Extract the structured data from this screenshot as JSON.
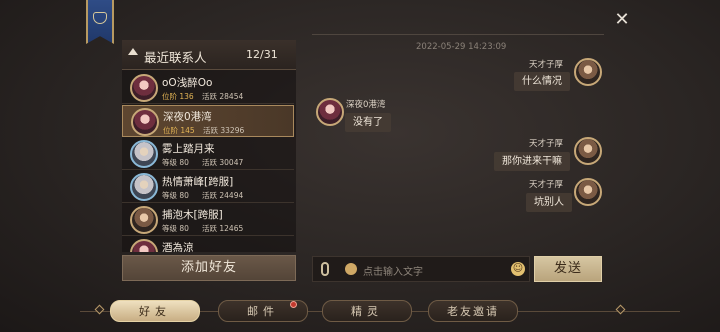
{
  "sidebar": {
    "header_title": "最近联系人",
    "count": "12/31",
    "contacts": [
      {
        "name": "oO浅醉Oo",
        "level": "位阶 136",
        "activity": "活跃 28454"
      },
      {
        "name": "深夜0港湾",
        "level": "位阶 145",
        "activity": "活跃 33296"
      },
      {
        "name": "雾上踏月来",
        "level": "等级 80",
        "activity": "活跃 30047"
      },
      {
        "name": "热情萧峰[跨服]",
        "level": "等级 80",
        "activity": "活跃 24494"
      },
      {
        "name": "捕泡木[跨服]",
        "level": "等级 80",
        "activity": "活跃 12465"
      },
      {
        "name": "酒為涼",
        "level": "",
        "activity": ""
      }
    ],
    "add_friend_label": "添加好友"
  },
  "chat": {
    "timestamp": "2022-05-29 14:23:09",
    "messages": [
      {
        "sender": "天才子厚",
        "text": "什么情况",
        "side": "right"
      },
      {
        "sender": "深夜0港湾",
        "text": "没有了",
        "side": "left"
      },
      {
        "sender": "天才子厚",
        "text": "那你进来干嘛",
        "side": "right"
      },
      {
        "sender": "天才子厚",
        "text": "坑别人",
        "side": "right"
      }
    ],
    "input_placeholder": "点击输入文字",
    "send_label": "发送"
  },
  "tabs": [
    {
      "label": "好友",
      "active": true
    },
    {
      "label": "邮件",
      "active": false,
      "badge": true
    },
    {
      "label": "精灵",
      "active": false
    },
    {
      "label": "老友邀请",
      "active": false
    }
  ],
  "icons": {
    "close": "close-icon",
    "mic": "microphone-icon",
    "emoji": "emoji-icon",
    "banner": "guild-banner-icon"
  },
  "colors": {
    "accent_gold": "#c8ae84",
    "selected_row": "#5e4630",
    "badge_red": "#c33a2e"
  }
}
